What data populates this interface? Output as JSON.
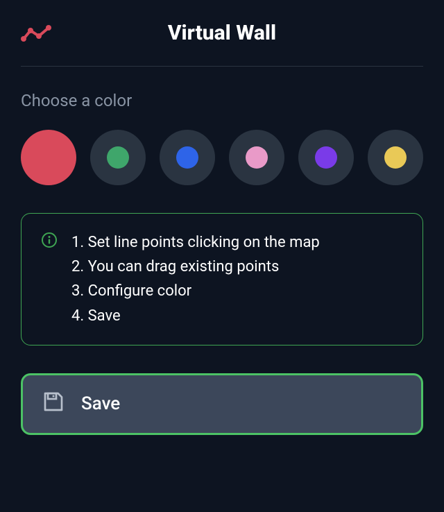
{
  "header": {
    "title": "Virtual Wall",
    "icon_name": "line-chart-icon"
  },
  "color_section": {
    "label": "Choose a color",
    "selected_index": 0,
    "colors": [
      "#d94a5b",
      "#3fa66b",
      "#2e64e8",
      "#e99ac8",
      "#7a3be8",
      "#e9c957"
    ]
  },
  "info": {
    "lines": [
      "1. Set line points clicking on the map",
      "2. You can drag existing points",
      "3. Configure color",
      "4. Save"
    ]
  },
  "save": {
    "label": "Save"
  }
}
